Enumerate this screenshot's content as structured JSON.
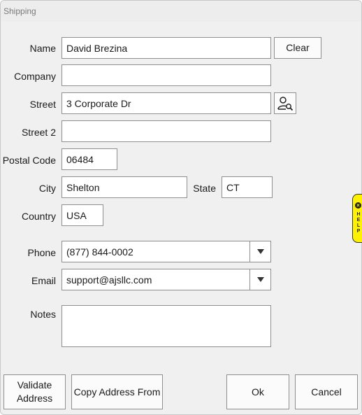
{
  "window": {
    "title": "Shipping"
  },
  "form": {
    "name": {
      "label": "Name",
      "value": "David Brezina"
    },
    "company": {
      "label": "Company",
      "value": ""
    },
    "street": {
      "label": "Street",
      "value": "3 Corporate Dr"
    },
    "street2": {
      "label": "Street 2",
      "value": ""
    },
    "postal_code": {
      "label": "Postal Code",
      "value": "06484"
    },
    "city": {
      "label": "City",
      "value": "Shelton"
    },
    "state": {
      "label": "State",
      "value": "CT"
    },
    "country": {
      "label": "Country",
      "value": "USA"
    },
    "phone": {
      "label": "Phone",
      "value": "(877) 844-0002"
    },
    "email": {
      "label": "Email",
      "value": "support@ajsllc.com"
    },
    "notes": {
      "label": "Notes",
      "value": ""
    }
  },
  "buttons": {
    "clear": "Clear",
    "validate_line1": "Validate",
    "validate_line2": "Address",
    "copy_address": "Copy Address From",
    "ok": "Ok",
    "cancel": "Cancel"
  },
  "help_tab": {
    "text": "HELP"
  },
  "colors": {
    "window_bg": "#f0f0f0",
    "help_tab": "#fff200"
  },
  "icons": {
    "street_lookup": "person-search-icon"
  }
}
